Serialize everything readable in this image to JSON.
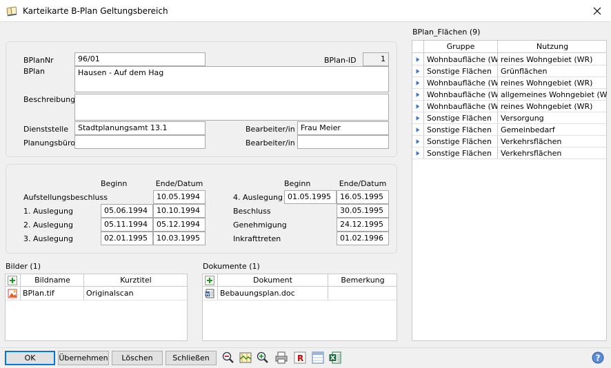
{
  "window": {
    "title": "Karteikarte B-Plan Geltungsbereich"
  },
  "plan": {
    "bplannr_label": "BPlanNr",
    "bplannr_value": "96/01",
    "bplanid_label": "BPlan-ID",
    "bplanid_value": "1",
    "bplan_label": "BPlan",
    "bplan_value": "Hausen - Auf dem Hag",
    "beschreibung_label": "Beschreibung",
    "beschreibung_value": "",
    "dienststelle_label": "Dienststelle",
    "dienststelle_value": "Stadtplanungsamt 13.1",
    "bearbeiter1_label": "Bearbeiter/in",
    "bearbeiter1_value": "Frau Meier",
    "planungsbuero_label": "Planungsbüro",
    "planungsbuero_value": "",
    "bearbeiter2_label": "Bearbeiter/in",
    "bearbeiter2_value": ""
  },
  "dates": {
    "left_header_beginn": "Beginn",
    "left_header_ende": "Ende/Datum",
    "right_header_beginn": "Beginn",
    "right_header_ende": "Ende/Datum",
    "aufstellung_label": "Aufstellungsbeschluss",
    "aufstellung_ende": "10.05.1994",
    "ausl1_label": "1. Auslegung",
    "ausl1_beginn": "05.06.1994",
    "ausl1_ende": "10.10.1994",
    "ausl2_label": "2. Auslegung",
    "ausl2_beginn": "05.11.1994",
    "ausl2_ende": "05.12.1994",
    "ausl3_label": "3. Auslegung",
    "ausl3_beginn": "02.01.1995",
    "ausl3_ende": "10.03.1995",
    "ausl4_label": "4. Auslegung",
    "ausl4_beginn": "01.05.1995",
    "ausl4_ende": "16.05.1995",
    "beschluss_label": "Beschluss",
    "beschluss_ende": "30.05.1995",
    "genehmigung_label": "Genehmigung",
    "genehmigung_ende": "24.12.1995",
    "inkraft_label": "Inkrafttreten",
    "inkraft_ende": "01.02.1996"
  },
  "flaechen": {
    "title": "BPlan_Flächen (9)",
    "col_gruppe": "Gruppe",
    "col_nutzung": "Nutzung",
    "rows": [
      {
        "gruppe": "Wohnbaufläche (W)",
        "nutzung": "reines Wohngebiet (WR)"
      },
      {
        "gruppe": "Sonstige Flächen",
        "nutzung": "Grünflächen"
      },
      {
        "gruppe": "Wohnbaufläche (W)",
        "nutzung": "reines Wohngebiet (WR)"
      },
      {
        "gruppe": "Wohnbaufläche (W)",
        "nutzung": "allgemeines Wohngebiet (WA)"
      },
      {
        "gruppe": "Wohnbaufläche (W)",
        "nutzung": "reines Wohngebiet (WR)"
      },
      {
        "gruppe": "Sonstige Flächen",
        "nutzung": "Versorgung"
      },
      {
        "gruppe": "Sonstige Flächen",
        "nutzung": "Gemeinbedarf"
      },
      {
        "gruppe": "Sonstige Flächen",
        "nutzung": "Verkehrsflächen"
      },
      {
        "gruppe": "Sonstige Flächen",
        "nutzung": "Verkehrsflächen"
      }
    ]
  },
  "bilder": {
    "title": "Bilder (1)",
    "col_bildname": "Bildname",
    "col_kurztitel": "Kurztitel",
    "rows": [
      {
        "bildname": "BPlan.tif",
        "kurztitel": "Originalscan"
      }
    ]
  },
  "dokumente": {
    "title": "Dokumente (1)",
    "col_dokument": "Dokument",
    "col_bemerkung": "Bemerkung",
    "rows": [
      {
        "dokument": "Bebauungsplan.doc",
        "bemerkung": ""
      }
    ]
  },
  "buttons": {
    "ok": "OK",
    "uebernehmen": "Übernehmen",
    "loeschen": "Löschen",
    "schliessen": "Schließen"
  },
  "icons": {
    "toolbar": [
      "zoom-out-icon",
      "map-icon",
      "zoom-in-icon",
      "print-icon",
      "report-icon",
      "table-icon",
      "excel-icon"
    ],
    "help": "help-icon"
  }
}
